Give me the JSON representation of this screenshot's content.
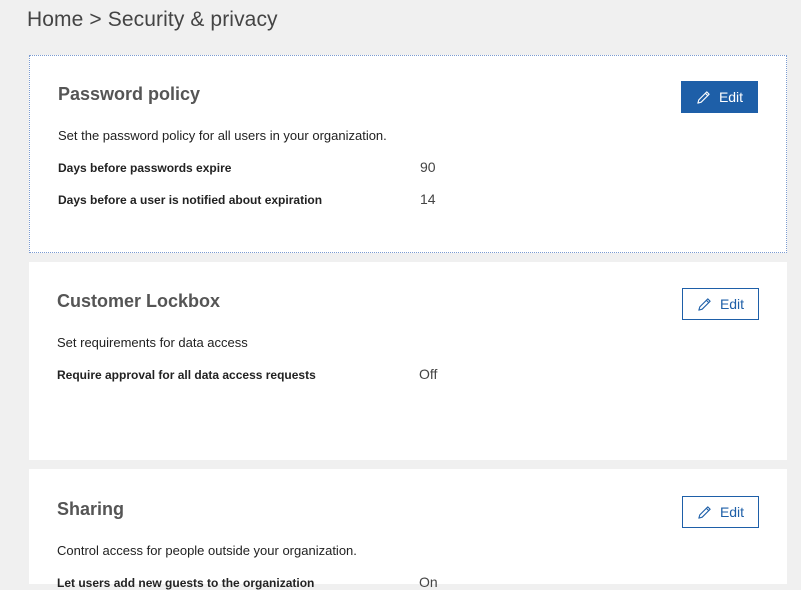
{
  "breadcrumb": {
    "home": "Home",
    "separator": ">",
    "current": "Security & privacy"
  },
  "colors": {
    "background": "#f0f0f0",
    "card": "#ffffff",
    "accent": "#1e5fa8"
  },
  "cards": [
    {
      "title": "Password policy",
      "edit_label": "Edit",
      "description": "Set the password policy for all users in your organization.",
      "rows": [
        {
          "label": "Days before passwords expire",
          "value": "90"
        },
        {
          "label": "Days before a user is notified about expiration",
          "value": "14"
        }
      ]
    },
    {
      "title": "Customer Lockbox",
      "edit_label": "Edit",
      "description": "Set requirements for data access",
      "rows": [
        {
          "label": "Require approval for all data access requests",
          "value": "Off"
        }
      ]
    },
    {
      "title": "Sharing",
      "edit_label": "Edit",
      "description": "Control access for people outside your organization.",
      "rows": [
        {
          "label": "Let users add new guests to the organization",
          "value": "On"
        }
      ]
    }
  ],
  "icons": {
    "edit": "pencil-icon"
  }
}
